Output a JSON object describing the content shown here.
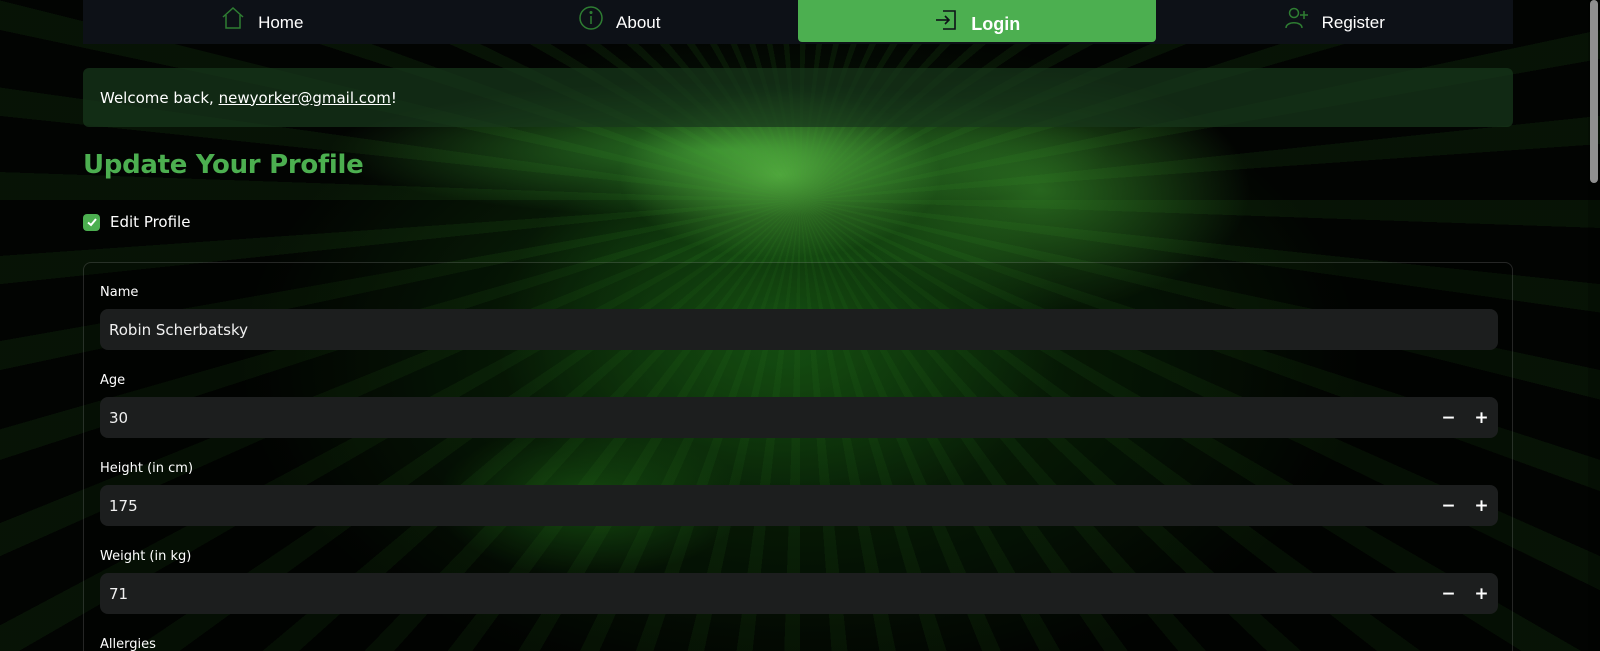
{
  "nav": {
    "items": [
      {
        "label": "Home",
        "icon": "home-icon"
      },
      {
        "label": "About",
        "icon": "info-icon"
      },
      {
        "label": "Login",
        "icon": "login-icon",
        "active": true
      },
      {
        "label": "Register",
        "icon": "add-user-icon"
      }
    ]
  },
  "welcome": {
    "prefix": "Welcome back, ",
    "email": "newyorker@gmail.com",
    "suffix": "!"
  },
  "page_title": "Update Your Profile",
  "edit_profile": {
    "label": "Edit Profile",
    "checked": true
  },
  "form": {
    "name": {
      "label": "Name",
      "value": "Robin Scherbatsky"
    },
    "age": {
      "label": "Age",
      "value": "30"
    },
    "height": {
      "label": "Height (in cm)",
      "value": "175"
    },
    "weight": {
      "label": "Weight (in kg)",
      "value": "71"
    },
    "allergies": {
      "label": "Allergies"
    }
  },
  "stepper": {
    "minus": "−",
    "plus": "+"
  },
  "colors": {
    "accent": "#4caf50",
    "navbar_bg": "#0d1117",
    "input_bg": "#1c1e1e"
  }
}
